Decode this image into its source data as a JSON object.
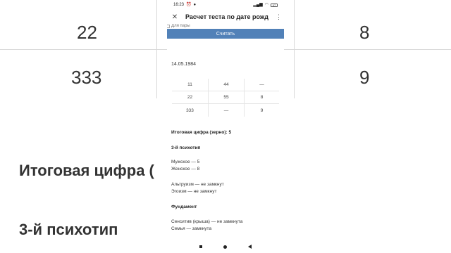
{
  "background": {
    "numbers": [
      "22",
      "8",
      "333",
      "9"
    ],
    "heading1": "Итоговая цифра (",
    "heading2": "3-й психотип"
  },
  "status_bar": {
    "time": "16:23",
    "battery": "97"
  },
  "toolbar": {
    "title": "Расчет теста по дате рожден"
  },
  "form": {
    "checkbox_label": "Для пары",
    "calc_button": "Считать"
  },
  "result": {
    "date": "14.05.1984",
    "grid": [
      [
        "11",
        "44",
        "—"
      ],
      [
        "22",
        "55",
        "8"
      ],
      [
        "333",
        "—",
        "9"
      ]
    ],
    "total": "Итоговая цифра (зерно): 5",
    "psychotype_heading": "3-й психотип",
    "male": "Мужское — 5",
    "female": "Женское — 8",
    "altruism": "Альтруизм — не замкнут",
    "egoism": "Эгоизм — не замкнут",
    "foundation_heading": "Фундамент",
    "sensitive": "Сенситив (крыша) — не замкнута",
    "family": "Семья — замкнута"
  },
  "colors": {
    "accent": "#5181b8"
  }
}
